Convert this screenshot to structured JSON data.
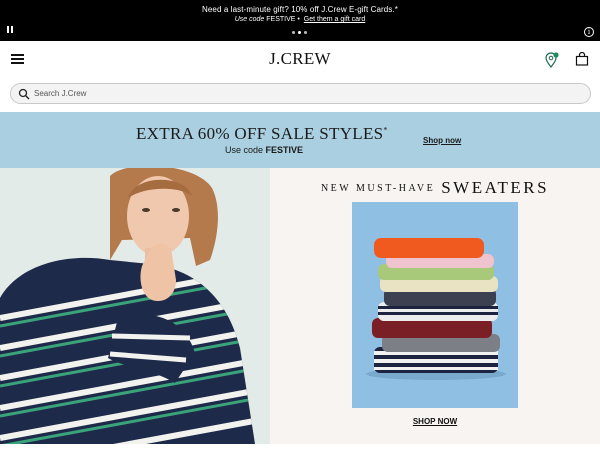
{
  "promo": {
    "message": "Need a last-minute gift? 10% off J.Crew E-gift Cards.*",
    "code_prefix": "Use code",
    "code": "FESTIVE",
    "separator": "•",
    "link": "Get them a gift card",
    "info_symbol": "i",
    "carousel_dots": 3,
    "active_dot": 1
  },
  "header": {
    "logo": "J.CREW",
    "icons": [
      "menu-icon",
      "store-location-icon",
      "shopping-bag-icon"
    ]
  },
  "search": {
    "placeholder": "Search J.Crew"
  },
  "sale_banner": {
    "headline": "EXTRA 60% OFF SALE STYLES",
    "headline_mark": "*",
    "code_prefix": "Use code",
    "code": "FESTIVE",
    "cta": "Shop now",
    "background": "#a9cfe0"
  },
  "hero": {
    "title_small": "NEW MUST-HAVE",
    "title_big": "SWEATERS",
    "cta": "SHOP NOW",
    "panel_background": "#f8f4f1",
    "card_background": "#8fc0e3"
  },
  "colors": {
    "promo_bar": "#000000",
    "text": "#111111"
  }
}
